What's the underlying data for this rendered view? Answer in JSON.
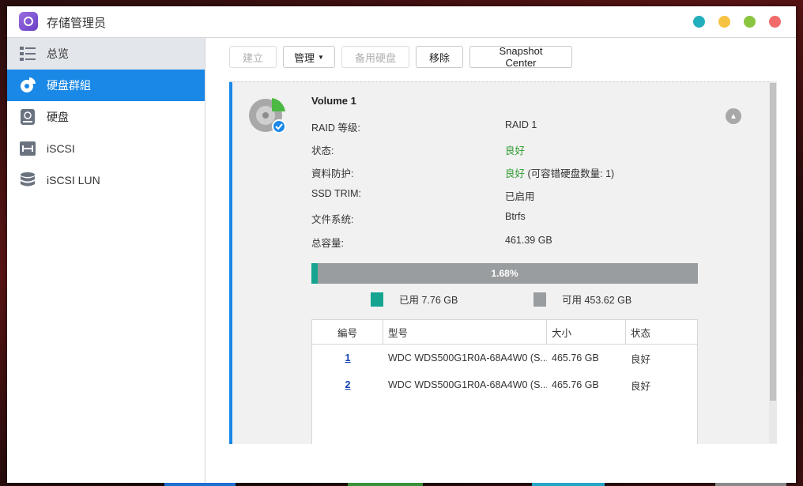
{
  "window": {
    "title": "存储管理员",
    "controls": [
      {
        "name": "window-info-button",
        "color": "#23aebd"
      },
      {
        "name": "window-minimize-button",
        "color": "#f5c242"
      },
      {
        "name": "window-maximize-button",
        "color": "#8bc53f"
      },
      {
        "name": "window-close-button",
        "color": "#f26a6a"
      }
    ]
  },
  "sidebar": {
    "items": [
      {
        "label": "总览",
        "icon": "list-icon",
        "state": "hover"
      },
      {
        "label": "硬盘群組",
        "icon": "pie-chart-icon",
        "state": "active"
      },
      {
        "label": "硬盘",
        "icon": "hard-disk-icon",
        "state": ""
      },
      {
        "label": "iSCSI",
        "icon": "iscsi-icon",
        "state": ""
      },
      {
        "label": "iSCSI LUN",
        "icon": "database-icon",
        "state": ""
      }
    ]
  },
  "toolbar": {
    "create_label": "建立",
    "manage_label": "管理",
    "spare_label": "备用硬盘",
    "remove_label": "移除",
    "snapshot_label": "Snapshot Center"
  },
  "volume": {
    "title": "Volume 1",
    "properties": [
      {
        "label": "RAID 等级:",
        "value": "RAID 1",
        "good": false
      },
      {
        "label": "状态:",
        "value": "良好",
        "good": true
      },
      {
        "label": "資料防护:",
        "value": "良好",
        "extra": " (可容错硬盘数量: 1)",
        "good": true
      },
      {
        "label": "SSD TRIM:",
        "value": "已启用",
        "good": false
      },
      {
        "label": "文件系统:",
        "value": "Btrfs",
        "good": false
      },
      {
        "label": "总容量:",
        "value": "461.39 GB",
        "good": false
      }
    ],
    "usage_percent_label": "1.68%",
    "usage_fraction": 0.0168,
    "used_label": "已用 7.76 GB",
    "free_label": "可用 453.62 GB",
    "used_color": "#16a491",
    "free_color": "#999d9f"
  },
  "disk_table": {
    "headers": [
      "編号",
      "型号",
      "大小",
      "状态"
    ],
    "rows": [
      {
        "id": "1",
        "model": "WDC WDS500G1R0A-68A4W0 (S...",
        "size": "465.76 GB",
        "status": "良好"
      },
      {
        "id": "2",
        "model": "WDC WDS500G1R0A-68A4W0 (S...",
        "size": "465.76 GB",
        "status": "良好"
      }
    ]
  }
}
